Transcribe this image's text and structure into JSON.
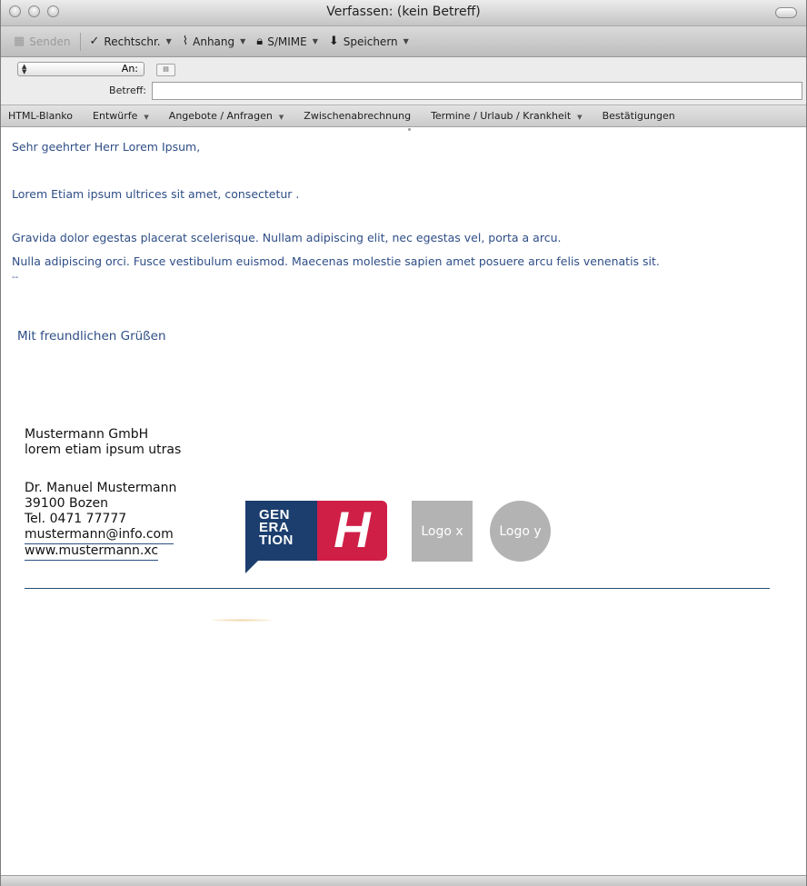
{
  "window": {
    "title": "Verfassen: (kein Betreff)"
  },
  "toolbar": {
    "send": "Senden",
    "spell": "Rechtschr.",
    "attach": "Anhang",
    "smime": "S/MIME",
    "save": "Speichern"
  },
  "address": {
    "to_label": "An:",
    "to_value": "",
    "subject_label": "Betreff:",
    "subject_value": ""
  },
  "stationery": [
    {
      "label": "HTML-Blanko",
      "dropdown": false
    },
    {
      "label": "Entwürfe",
      "dropdown": true
    },
    {
      "label": "Angebote / Anfragen",
      "dropdown": true
    },
    {
      "label": "Zwischenabrechnung",
      "dropdown": false
    },
    {
      "label": "Termine / Urlaub / Krankheit",
      "dropdown": true
    },
    {
      "label": "Bestätigungen",
      "dropdown": false
    }
  ],
  "message": {
    "greeting": "Sehr geehrter Herr Lorem Ipsum,",
    "line1": "Lorem Etiam ipsum ultrices  sit amet, consectetur .",
    "line2": "Gravida dolor egestas placerat scelerisque. Nullam adipiscing elit, nec egestas vel, porta a arcu.",
    "line3": "Nulla adipiscing orci. Fusce vestibulum euismod. Maecenas molestie sapien amet posuere arcu felis venenatis sit.",
    "sig_sep": "--",
    "closing": "Mit freundlichen Grüßen"
  },
  "signature": {
    "company": "Mustermann GmbH",
    "tagline": "lorem etiam ipsum utras",
    "name": "Dr. Manuel Mustermann",
    "city": "39100 Bozen",
    "phone": "Tel. 0471 77777",
    "email": "mustermann@info.com",
    "web": "www.mustermann.xc"
  },
  "logos": {
    "generation_lines": [
      "GEN",
      "ERA",
      "TION"
    ],
    "generation_mark": "H",
    "logo_x": "Logo x",
    "logo_y": "Logo y",
    "colors": {
      "blue": "#1b3e6e",
      "red": "#cf1f47",
      "gray": "#b3b3b3"
    }
  }
}
